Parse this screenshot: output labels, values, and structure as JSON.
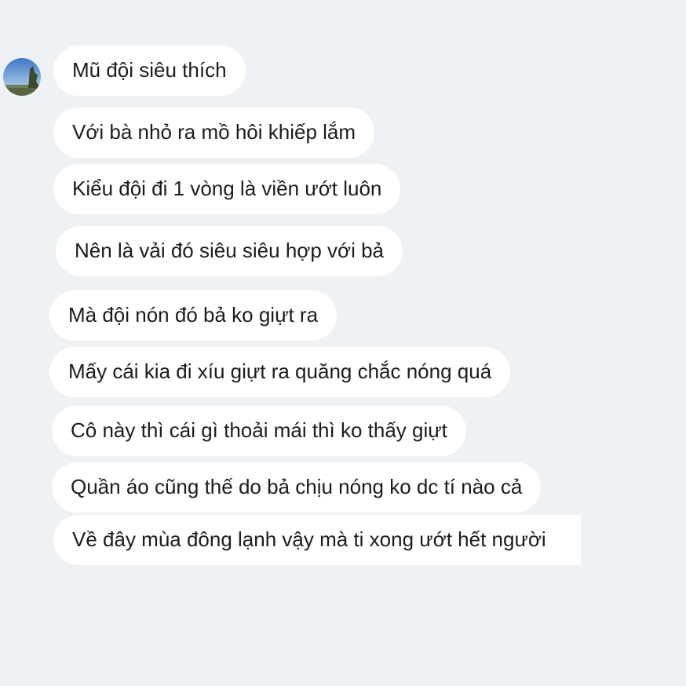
{
  "chat": {
    "avatar": {
      "icon": "landscape-avatar-icon"
    },
    "messages": [
      "Mũ đội siêu thích",
      "Với bà nhỏ ra mồ hôi khiếp lắm",
      "Kiểu đội đi 1 vòng là viền ướt luôn",
      "Nên là vải đó siêu siêu hợp với bả",
      "Mà đội nón đó bả ko giựt ra",
      "Mấy cái kia đi xíu giựt ra quăng chắc nóng quá",
      "Cô này thì cái gì thoải mái thì ko thấy giựt",
      "Quần áo cũng thế do bả chịu nóng ko dc tí nào cả",
      "Về đây mùa đông lạnh vậy mà ti xong ướt hết người"
    ]
  }
}
